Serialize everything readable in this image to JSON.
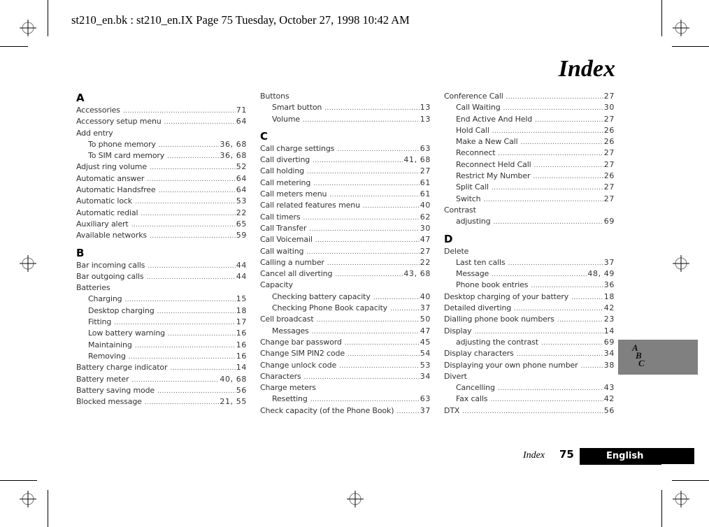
{
  "header": {
    "stamp": "st210_en.bk : st210_en.IX  Page 75  Tuesday, October 27, 1998  10:42 AM"
  },
  "page_title": "Index",
  "columns": [
    {
      "entries": [
        {
          "type": "letter",
          "label": "A"
        },
        {
          "type": "entry",
          "label": "Accessories",
          "pages": "71"
        },
        {
          "type": "entry",
          "label": "Accessory setup menu",
          "pages": "64"
        },
        {
          "type": "entry",
          "label": "Add entry",
          "pages": ""
        },
        {
          "type": "sub",
          "label": "To phone memory",
          "pages": "36, 68"
        },
        {
          "type": "sub",
          "label": "To SIM card memory",
          "pages": "36, 68"
        },
        {
          "type": "entry",
          "label": "Adjust ring volume",
          "pages": "52"
        },
        {
          "type": "entry",
          "label": "Automatic answer",
          "pages": "64"
        },
        {
          "type": "entry",
          "label": "Automatic Handsfree",
          "pages": "64"
        },
        {
          "type": "entry",
          "label": "Automatic lock",
          "pages": "53"
        },
        {
          "type": "entry",
          "label": "Automatic redial",
          "pages": "22"
        },
        {
          "type": "entry",
          "label": "Auxiliary alert",
          "pages": "65"
        },
        {
          "type": "entry",
          "label": "Available networks",
          "pages": "59"
        },
        {
          "type": "letter",
          "label": "B"
        },
        {
          "type": "entry",
          "label": "Bar incoming calls",
          "pages": "44"
        },
        {
          "type": "entry",
          "label": "Bar outgoing calls",
          "pages": "44"
        },
        {
          "type": "entry",
          "label": "Batteries",
          "pages": ""
        },
        {
          "type": "sub",
          "label": "Charging",
          "pages": "15"
        },
        {
          "type": "sub",
          "label": "Desktop charging",
          "pages": "18"
        },
        {
          "type": "sub",
          "label": "Fitting",
          "pages": "17"
        },
        {
          "type": "sub",
          "label": "Low battery warning",
          "pages": "16"
        },
        {
          "type": "sub",
          "label": "Maintaining",
          "pages": "16"
        },
        {
          "type": "sub",
          "label": "Removing",
          "pages": "16"
        },
        {
          "type": "entry",
          "label": "Battery charge indicator",
          "pages": "14"
        },
        {
          "type": "entry",
          "label": "Battery meter",
          "pages": "40, 68"
        },
        {
          "type": "entry",
          "label": "Battery saving mode",
          "pages": "56"
        },
        {
          "type": "entry",
          "label": "Blocked message",
          "pages": "21, 55"
        }
      ]
    },
    {
      "entries": [
        {
          "type": "entry",
          "label": "Buttons",
          "pages": ""
        },
        {
          "type": "sub",
          "label": "Smart button",
          "pages": "13"
        },
        {
          "type": "sub",
          "label": "Volume",
          "pages": "13"
        },
        {
          "type": "letter",
          "label": "C"
        },
        {
          "type": "entry",
          "label": "Call charge settings",
          "pages": "63"
        },
        {
          "type": "entry",
          "label": "Call diverting",
          "pages": "41, 68"
        },
        {
          "type": "entry",
          "label": "Call holding",
          "pages": "27"
        },
        {
          "type": "entry",
          "label": "Call metering",
          "pages": "61"
        },
        {
          "type": "entry",
          "label": "Call meters menu",
          "pages": "61"
        },
        {
          "type": "entry",
          "label": "Call related features menu",
          "pages": "40"
        },
        {
          "type": "entry",
          "label": "Call timers",
          "pages": "62"
        },
        {
          "type": "entry",
          "label": "Call Transfer",
          "pages": "30"
        },
        {
          "type": "entry",
          "label": "Call Voicemail",
          "pages": "47"
        },
        {
          "type": "entry",
          "label": "Call waiting",
          "pages": "27"
        },
        {
          "type": "entry",
          "label": "Calling a number",
          "pages": "22"
        },
        {
          "type": "entry",
          "label": "Cancel all diverting",
          "pages": "43, 68"
        },
        {
          "type": "entry",
          "label": "Capacity",
          "pages": ""
        },
        {
          "type": "sub",
          "label": "Checking battery capacity",
          "pages": "40"
        },
        {
          "type": "sub",
          "label": "Checking Phone Book capacity",
          "pages": "37"
        },
        {
          "type": "entry",
          "label": "Cell broadcast",
          "pages": "50"
        },
        {
          "type": "sub",
          "label": "Messages",
          "pages": "47"
        },
        {
          "type": "entry",
          "label": "Change bar password",
          "pages": "45"
        },
        {
          "type": "entry",
          "label": "Change SIM PIN2 code",
          "pages": "54"
        },
        {
          "type": "entry",
          "label": "Change unlock code",
          "pages": "53"
        },
        {
          "type": "entry",
          "label": "Characters",
          "pages": "34"
        },
        {
          "type": "entry",
          "label": "Charge meters",
          "pages": ""
        },
        {
          "type": "sub",
          "label": "Resetting",
          "pages": "63"
        },
        {
          "type": "entry",
          "label": "Check capacity (of the Phone Book)",
          "pages": "37"
        }
      ]
    },
    {
      "entries": [
        {
          "type": "entry",
          "label": "Conference Call",
          "pages": "27"
        },
        {
          "type": "sub",
          "label": "Call Waiting",
          "pages": "30"
        },
        {
          "type": "sub",
          "label": "End Active And Held",
          "pages": "27"
        },
        {
          "type": "sub",
          "label": "Hold Call",
          "pages": "26"
        },
        {
          "type": "sub",
          "label": "Make a New Call",
          "pages": "26"
        },
        {
          "type": "sub",
          "label": "Reconnect",
          "pages": "27"
        },
        {
          "type": "sub",
          "label": "Reconnect Held Call",
          "pages": "27"
        },
        {
          "type": "sub",
          "label": "Restrict My Number",
          "pages": "26"
        },
        {
          "type": "sub",
          "label": "Split Call",
          "pages": "27"
        },
        {
          "type": "sub",
          "label": "Switch",
          "pages": "27"
        },
        {
          "type": "entry",
          "label": "Contrast",
          "pages": ""
        },
        {
          "type": "sub",
          "label": "adjusting",
          "pages": "69"
        },
        {
          "type": "letter",
          "label": "D"
        },
        {
          "type": "entry",
          "label": "Delete",
          "pages": ""
        },
        {
          "type": "sub",
          "label": "Last ten calls",
          "pages": "37"
        },
        {
          "type": "sub",
          "label": "Message",
          "pages": "48, 49"
        },
        {
          "type": "sub",
          "label": "Phone book entries",
          "pages": "36"
        },
        {
          "type": "entry",
          "label": "Desktop charging of your battery",
          "pages": "18"
        },
        {
          "type": "entry",
          "label": "Detailed diverting",
          "pages": "42"
        },
        {
          "type": "entry",
          "label": "Dialling phone book numbers",
          "pages": "23"
        },
        {
          "type": "entry",
          "label": "Display",
          "pages": "14"
        },
        {
          "type": "sub",
          "label": "adjusting the contrast",
          "pages": "69"
        },
        {
          "type": "entry",
          "label": "Display characters",
          "pages": "34"
        },
        {
          "type": "entry",
          "label": "Displaying your own phone number",
          "pages": "38"
        },
        {
          "type": "entry",
          "label": "Divert",
          "pages": ""
        },
        {
          "type": "sub",
          "label": "Cancelling",
          "pages": "43"
        },
        {
          "type": "sub",
          "label": "Fax calls",
          "pages": "42"
        },
        {
          "type": "entry",
          "label": "DTX",
          "pages": "56"
        }
      ]
    }
  ],
  "thumb_tab": {
    "letters": [
      "A",
      "B",
      "C"
    ],
    "color": "#808080"
  },
  "footer": {
    "section": "Index",
    "page_number": "75",
    "language": "English"
  },
  "icons": {
    "registration_mark": "crosshair-circle"
  }
}
